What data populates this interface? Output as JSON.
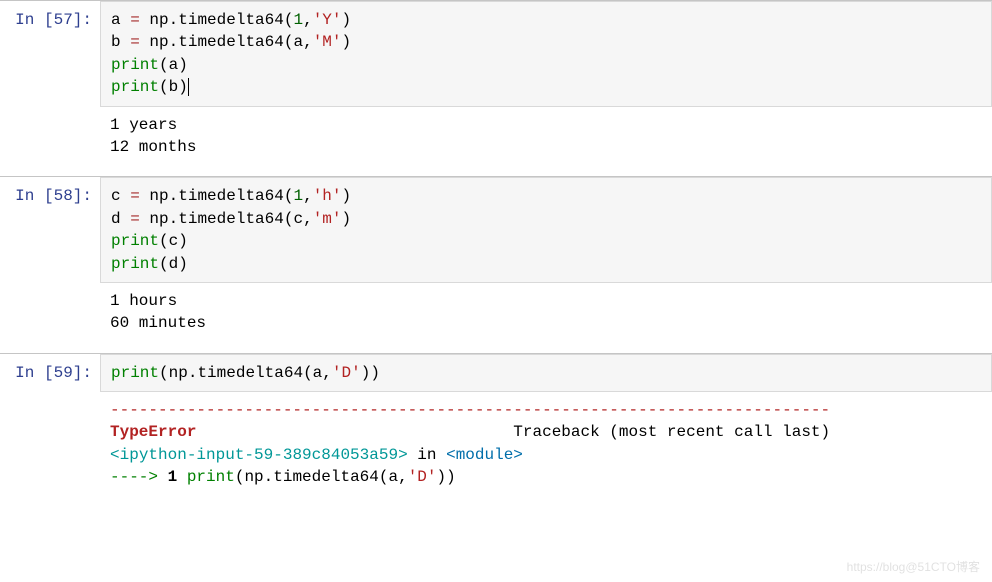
{
  "cells": [
    {
      "promptLabel": "In ",
      "promptNum": "[57]:",
      "code": {
        "line1_a": "a",
        "line1_eq": " = ",
        "line1_np": "np",
        "line1_dot": ".",
        "line1_fn": "timedelta64",
        "line1_lp": "(",
        "line1_arg1": "1",
        "line1_comma": ",",
        "line1_arg2": "'Y'",
        "line1_rp": ")",
        "line2_b": "b",
        "line2_eq": " = ",
        "line2_np": "np",
        "line2_dot": ".",
        "line2_fn": "timedelta64",
        "line2_lp": "(",
        "line2_arg1": "a",
        "line2_comma": ",",
        "line2_arg2": "'M'",
        "line2_rp": ")",
        "line3_print": "print",
        "line3_lp": "(",
        "line3_arg": "a",
        "line3_rp": ")",
        "line4_print": "print",
        "line4_lp": "(",
        "line4_arg": "b",
        "line4_rp": ")"
      },
      "output": "1 years\n12 months"
    },
    {
      "promptLabel": "In ",
      "promptNum": "[58]:",
      "code": {
        "line1_a": "c",
        "line1_eq": " = ",
        "line1_np": "np",
        "line1_dot": ".",
        "line1_fn": "timedelta64",
        "line1_lp": "(",
        "line1_arg1": "1",
        "line1_comma": ",",
        "line1_arg2": "'h'",
        "line1_rp": ")",
        "line2_b": "d",
        "line2_eq": " = ",
        "line2_np": "np",
        "line2_dot": ".",
        "line2_fn": "timedelta64",
        "line2_lp": "(",
        "line2_arg1": "c",
        "line2_comma": ",",
        "line2_arg2": "'m'",
        "line2_rp": ")",
        "line3_print": "print",
        "line3_lp": "(",
        "line3_arg": "c",
        "line3_rp": ")",
        "line4_print": "print",
        "line4_lp": "(",
        "line4_arg": "d",
        "line4_rp": ")"
      },
      "output": "1 hours\n60 minutes"
    },
    {
      "promptLabel": "In ",
      "promptNum": "[59]:",
      "code": {
        "line1_print": "print",
        "line1_lp": "(",
        "line1_np": "np",
        "line1_dot": ".",
        "line1_fn": "timedelta64",
        "line1_lp2": "(",
        "line1_arg1": "a",
        "line1_comma": ",",
        "line1_arg2": "'D'",
        "line1_rp2": ")",
        "line1_rp": ")"
      },
      "error": {
        "hr": "---------------------------------------------------------------------------",
        "typeName": "TypeError",
        "traceLabel": "Traceback (most recent call last)",
        "locOpen": "<",
        "locBody": "ipython-input-59-389c84053a59",
        "locClose": ">",
        "locIn": " in ",
        "modOpen": "<",
        "modBody": "module",
        "modClose": ">",
        "arrow": "----> ",
        "arrowNum": "1 ",
        "trLine_print": "print",
        "trLine_lp": "(",
        "trLine_np": "np",
        "trLine_dot": ".",
        "trLine_fn": "timedelta64",
        "trLine_lp2": "(",
        "trLine_arg1": "a",
        "trLine_comma": ",",
        "trLine_arg2": "'D'",
        "trLine_rp2": ")",
        "trLine_rp": ")"
      }
    }
  ],
  "watermark": "https://blog@51CTO博客"
}
